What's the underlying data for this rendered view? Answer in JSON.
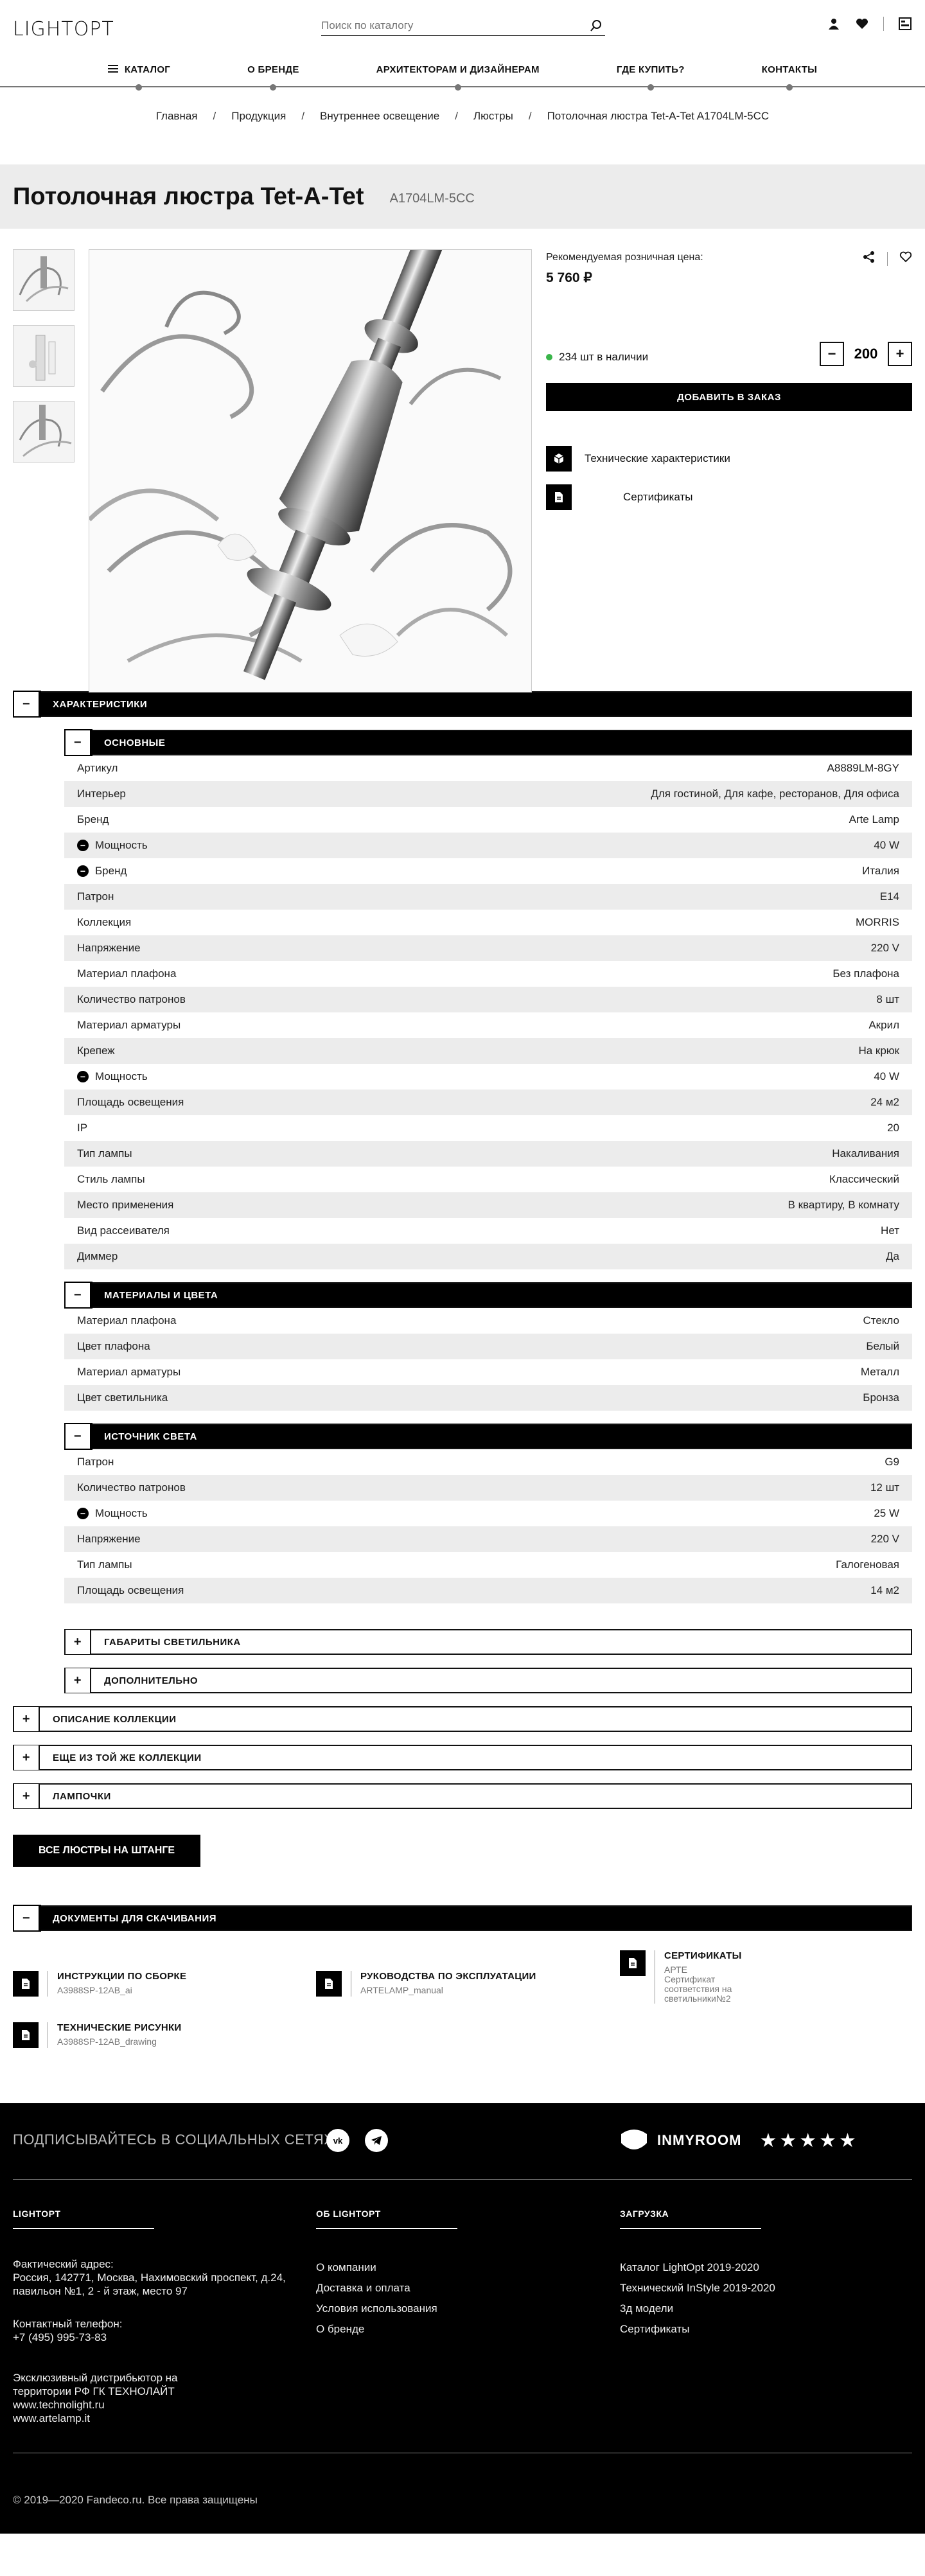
{
  "header": {
    "logo": "LIGHTOPT",
    "search_placeholder": "Поиск по каталогу",
    "icons": [
      "user-icon",
      "heart-icon",
      "catalog-icon"
    ]
  },
  "nav": {
    "items": [
      "КАТАЛОГ",
      "О БРЕНДЕ",
      "АРХИТЕКТОРАМ И ДИЗАЙНЕРАМ",
      "ГДЕ КУПИТЬ?",
      "КОНТАКТЫ"
    ]
  },
  "breadcrumbs": [
    "Главная",
    "Продукция",
    "Внутреннее освещение",
    "Люстры",
    "Потолочная люстра Tet-A-Tet A1704LM-5CC"
  ],
  "product": {
    "title": "Потолочная люстра Tet-A-Tet",
    "sku": "A1704LM-5CC",
    "price_label": "Рекомендуемая розничная цена:",
    "price": "5 760 ₽",
    "stock": "234 шт в наличии",
    "qty": "200",
    "qty_minus": "−",
    "qty_plus": "+",
    "add_label": "ДОБАВИТЬ В ЗАКАЗ",
    "tech_link": "Технические характеристики",
    "cert_link": "Сертификаты",
    "stock_color": "#3ab54a"
  },
  "characteristics": {
    "title": "ХАРАКТЕРИСТИКИ",
    "groups": [
      {
        "title": "ОСНОВНЫЕ",
        "rows": [
          {
            "k": "Артикул",
            "v": "A8889LM-8GY",
            "m": false
          },
          {
            "k": "Интерьер",
            "v": "Для гостиной, Для кафе, ресторанов, Для офиса",
            "m": false
          },
          {
            "k": "Бренд",
            "v": "Arte Lamp",
            "m": false
          },
          {
            "k": "Мощность",
            "v": "40 W",
            "m": true
          },
          {
            "k": "Бренд",
            "v": "Италия",
            "m": true
          },
          {
            "k": "Патрон",
            "v": "E14",
            "m": false
          },
          {
            "k": "Коллекция",
            "v": "MORRIS",
            "m": false
          },
          {
            "k": "Напряжение",
            "v": "220 V",
            "m": false
          },
          {
            "k": "Материал плафона",
            "v": "Без плафона",
            "m": false
          },
          {
            "k": "Количество патронов",
            "v": "8 шт",
            "m": false
          },
          {
            "k": "Материал арматуры",
            "v": "Акрил",
            "m": false
          },
          {
            "k": "Крепеж",
            "v": "На крюк",
            "m": false
          },
          {
            "k": "Мощность",
            "v": "40 W",
            "m": true
          },
          {
            "k": "Площадь освещения",
            "v": "24 м2",
            "m": false
          },
          {
            "k": "IP",
            "v": "20",
            "m": false
          },
          {
            "k": "Тип лампы",
            "v": "Накаливания",
            "m": false
          },
          {
            "k": "Стиль лампы",
            "v": "Классический",
            "m": false
          },
          {
            "k": "Место применения",
            "v": "В квартиру, В комнату",
            "m": false
          },
          {
            "k": "Вид рассеивателя",
            "v": "Нет",
            "m": false
          },
          {
            "k": "Диммер",
            "v": "Да",
            "m": false
          }
        ]
      },
      {
        "title": "МАТЕРИАЛЫ И ЦВЕТА",
        "rows": [
          {
            "k": "Материал плафона",
            "v": "Стекло",
            "m": false
          },
          {
            "k": "Цвет плафона",
            "v": "Белый",
            "m": false
          },
          {
            "k": "Материал арматуры",
            "v": "Металл",
            "m": false
          },
          {
            "k": "Цвет светильника",
            "v": "Бронза",
            "m": false
          }
        ]
      },
      {
        "title": "ИСТОЧНИК СВЕТА",
        "rows": [
          {
            "k": "Патрон",
            "v": "G9",
            "m": false
          },
          {
            "k": "Количество патронов",
            "v": "12 шт",
            "m": false
          },
          {
            "k": "Мощность",
            "v": "25 W",
            "m": true
          },
          {
            "k": "Напряжение",
            "v": "220 V",
            "m": false
          },
          {
            "k": "Тип лампы",
            "v": "Галогеновая",
            "m": false
          },
          {
            "k": "Площадь освещения",
            "v": "14 м2",
            "m": false
          }
        ]
      }
    ],
    "collapsed_sub": [
      "ГАБАРИТЫ СВЕТИЛЬНИКА",
      "ДОПОЛНИТЕЛЬНО"
    ]
  },
  "collapsed_sections": [
    "ОПИСАНИЕ КОЛЛЕКЦИИ",
    "ЕЩЕ ИЗ ТОЙ ЖЕ КОЛЛЕКЦИИ",
    "ЛАМПОЧКИ"
  ],
  "toggle_open": "−",
  "toggle_closed": "+",
  "all_button": "ВСЕ ЛЮСТРЫ НА ШТАНГЕ",
  "documents": {
    "title": "ДОКУМЕНТЫ ДЛЯ СКАЧИВАНИЯ",
    "items": [
      {
        "title": "ИНСТРУКЦИИ ПО СБОРКЕ",
        "sub": "A3988SP-12AB_ai"
      },
      {
        "title": "РУКОВОДСТВА ПО ЭКСПЛУАТАЦИИ",
        "sub": "ARTELAMP_manual"
      },
      {
        "title": "СЕРТИФИКАТЫ",
        "sub": "АРТЕ\nСертификат соответствия на светильники№2"
      },
      {
        "title": "ТЕХНИЧЕСКИЕ РИСУНКИ",
        "sub": "A3988SP-12AB_drawing"
      }
    ]
  },
  "footer": {
    "social_label": "ПОДПИСЫВАЙТЕСЬ В СОЦИАЛЬНЫХ СЕТЯХ",
    "brand": "INMYROOM",
    "stars": 5,
    "col1_title": "LIGHTOPT",
    "address_label": "Фактический адрес:",
    "address": "Россия, 142771, Москва, Нахимовский проспект, д.24, павильон №1, 2 - й этаж, место 97",
    "phone_label": "Контактный телефон:",
    "phone": "+7 (495) 995-73-83",
    "distributor": "Эксклюзивный дистрибьютор на территории РФ ГК ТЕХНОЛАЙТ",
    "site1": "www.technolight.ru",
    "site2": "www.artelamp.it",
    "col2_title": "ОБ LIGHTOPT",
    "col2_links": [
      "О компании",
      "Доставка и оплата",
      "Условия использования",
      "О бренде"
    ],
    "col3_title": "ЗАГРУЗКА",
    "col3_links": [
      "Каталог LightOpt 2019-2020",
      "Технический InStyle 2019-2020",
      "3д модели",
      "Сертификаты"
    ],
    "copyright": "© 2019—2020 Fandeco.ru. Все права защищены"
  }
}
